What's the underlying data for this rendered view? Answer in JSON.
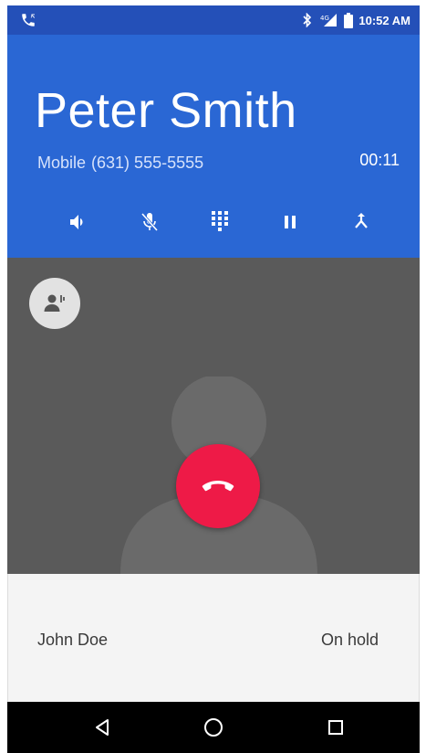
{
  "status_bar": {
    "time": "10:52 AM",
    "icons": [
      "phone-call-icon",
      "bluetooth-icon",
      "signal-icon",
      "battery-icon"
    ]
  },
  "call": {
    "caller_name": "Peter Smith",
    "number_type": "Mobile",
    "number": "(631) 555-5555",
    "timer": "00:11",
    "actions": [
      "speaker-icon",
      "mute-icon",
      "dialpad-icon",
      "hold-icon",
      "merge-icon"
    ]
  },
  "secondary_call": {
    "name": "John Doe",
    "status": "On hold"
  },
  "navigation": {
    "buttons": [
      "back-icon",
      "home-icon",
      "recents-icon"
    ]
  },
  "colors": {
    "status_bar": "#2450b8",
    "header": "#2a67d4",
    "photo_background": "#5a5a5a",
    "end_call": "#ee1a47",
    "secondary_bar": "#f4f4f4",
    "nav_bar": "#000000"
  }
}
